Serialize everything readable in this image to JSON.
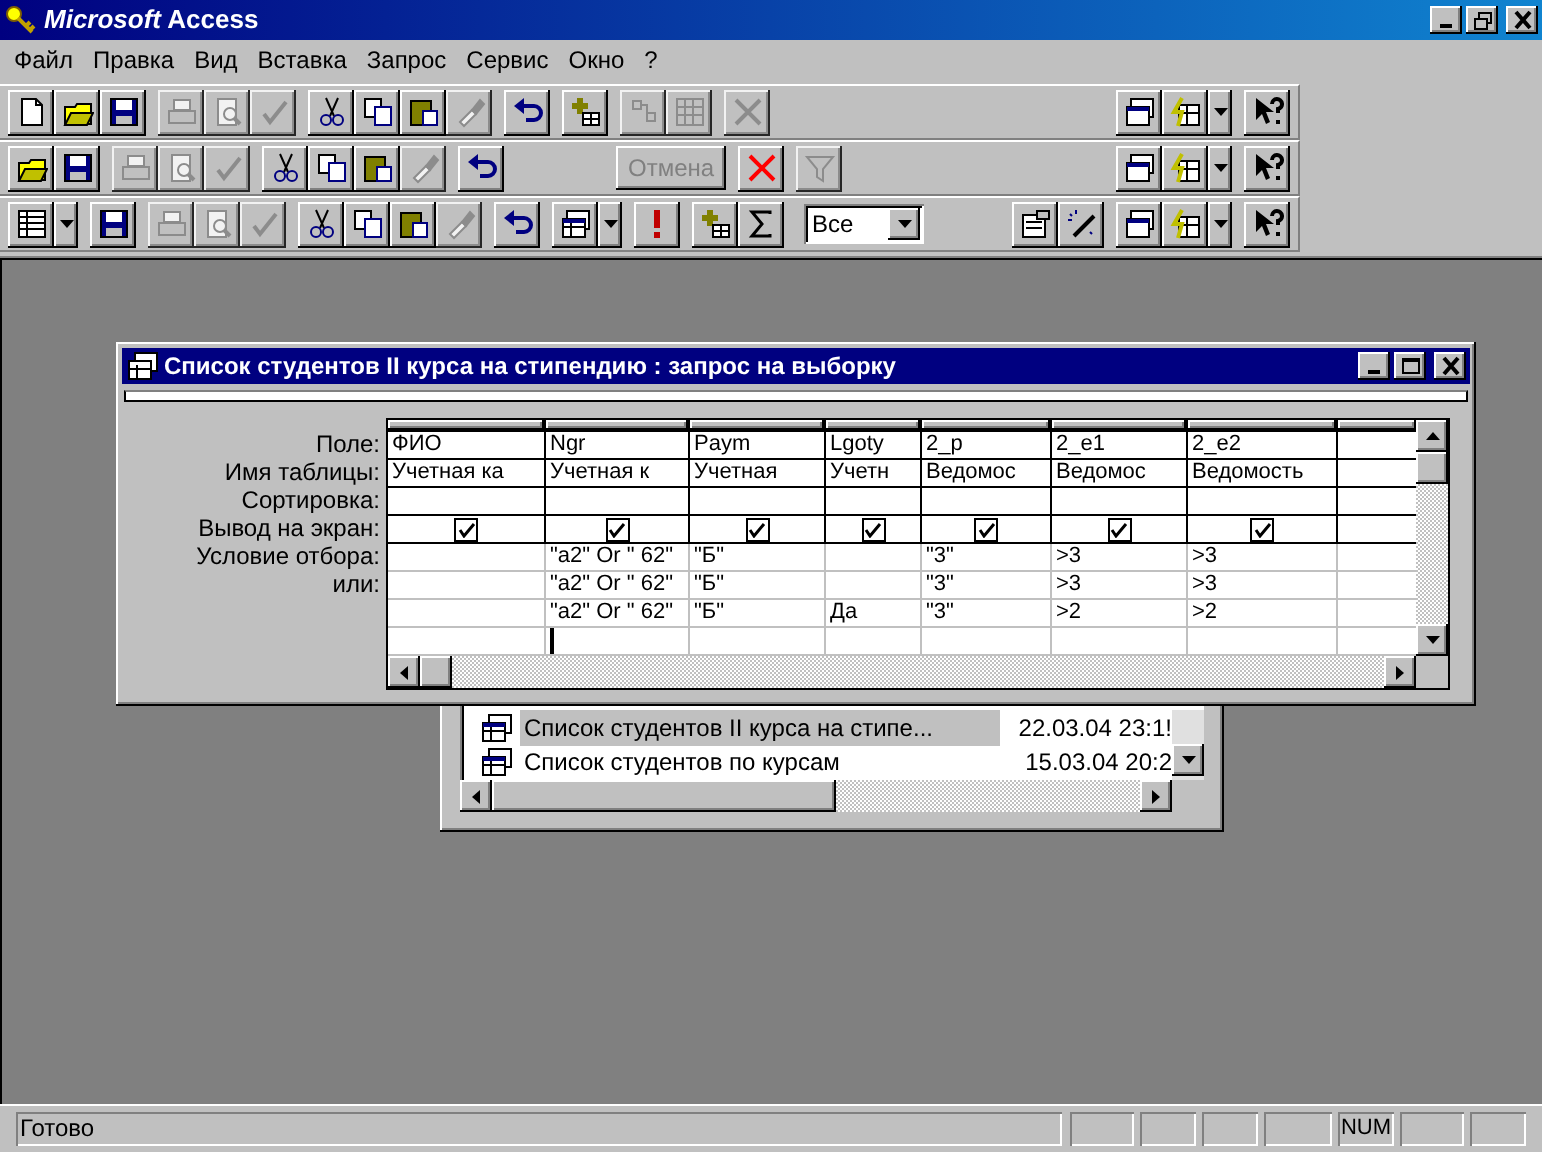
{
  "window": {
    "title": "**Microsoft** Access"
  },
  "menu": [
    "Файл",
    "Правка",
    "Вид",
    "Вставка",
    "Запрос",
    "Сервис",
    "Окно",
    "?"
  ],
  "toolbars": [
    {
      "left": [
        [
          {
            "kind": "new",
            "disabled": false
          },
          {
            "kind": "open",
            "disabled": false
          },
          {
            "kind": "save",
            "disabled": false
          }
        ],
        [
          {
            "kind": "print",
            "disabled": true
          },
          {
            "kind": "preview",
            "disabled": true
          },
          {
            "kind": "spell",
            "disabled": true
          }
        ],
        [
          {
            "kind": "cut",
            "disabled": false
          },
          {
            "kind": "copy",
            "disabled": false
          },
          {
            "kind": "paste",
            "disabled": false
          },
          {
            "kind": "painter",
            "disabled": true
          }
        ],
        [
          {
            "kind": "undo",
            "disabled": false
          }
        ],
        [
          {
            "kind": "new_record",
            "disabled": false
          }
        ],
        [
          {
            "kind": "relations",
            "disabled": true
          },
          {
            "kind": "analyze",
            "disabled": true
          }
        ],
        [
          {
            "kind": "delete",
            "disabled": true
          }
        ]
      ],
      "right": [
        [
          {
            "kind": "db_window",
            "disabled": false
          },
          {
            "kind": "new_object",
            "disabled": false
          }
        ],
        [
          {
            "kind": "help",
            "disabled": false
          }
        ]
      ]
    },
    {
      "left": [
        [
          {
            "kind": "open",
            "disabled": false
          },
          {
            "kind": "save",
            "disabled": false
          }
        ],
        [
          {
            "kind": "print",
            "disabled": true
          },
          {
            "kind": "preview",
            "disabled": true
          },
          {
            "kind": "spell",
            "disabled": true
          }
        ],
        [
          {
            "kind": "cut",
            "disabled": false
          },
          {
            "kind": "copy",
            "disabled": false
          },
          {
            "kind": "paste",
            "disabled": false
          },
          {
            "kind": "painter",
            "disabled": true
          }
        ],
        [
          {
            "kind": "undo",
            "disabled": false
          }
        ],
        [
          {
            "kind": "text",
            "label": "Отмена",
            "disabled": true
          }
        ],
        [
          {
            "kind": "stop",
            "disabled": false
          }
        ],
        [
          {
            "kind": "filter",
            "disabled": true
          }
        ]
      ],
      "right": [
        [
          {
            "kind": "db_window",
            "disabled": false
          },
          {
            "kind": "new_object",
            "disabled": false
          }
        ],
        [
          {
            "kind": "help",
            "disabled": false
          }
        ]
      ]
    },
    {
      "left": [
        [
          {
            "kind": "view",
            "disabled": false
          }
        ],
        [
          {
            "kind": "save",
            "disabled": false
          }
        ],
        [
          {
            "kind": "print",
            "disabled": true
          },
          {
            "kind": "preview",
            "disabled": true
          },
          {
            "kind": "spell",
            "disabled": true
          }
        ],
        [
          {
            "kind": "cut",
            "disabled": false
          },
          {
            "kind": "copy",
            "disabled": false
          },
          {
            "kind": "paste",
            "disabled": false
          },
          {
            "kind": "painter",
            "disabled": true
          }
        ],
        [
          {
            "kind": "undo",
            "disabled": false
          }
        ],
        [
          {
            "kind": "query_type",
            "disabled": false
          }
        ],
        [
          {
            "kind": "run",
            "disabled": false
          }
        ],
        [
          {
            "kind": "show_table",
            "disabled": false
          },
          {
            "kind": "totals",
            "disabled": false
          }
        ],
        [
          {
            "kind": "combo",
            "value": "Все"
          }
        ]
      ],
      "right": [
        [
          {
            "kind": "properties",
            "disabled": false
          },
          {
            "kind": "builder",
            "disabled": false
          }
        ],
        [
          {
            "kind": "db_window",
            "disabled": false
          },
          {
            "kind": "new_object",
            "disabled": false
          }
        ],
        [
          {
            "kind": "help",
            "disabled": false
          }
        ]
      ]
    }
  ],
  "query_window": {
    "title": "Список студентов II курса на стипендию : запрос на выборку",
    "grid": {
      "rows": [
        {
          "label": "Поле:",
          "kind": "text",
          "cells": [
            "ФИО",
            "Ngr",
            "Paym",
            "Lgoty",
            "2_p",
            "2_e1",
            "2_e2"
          ]
        },
        {
          "label": "Имя таблицы:",
          "kind": "text",
          "cells": [
            "Учетная ка",
            "Учетная к",
            "Учетная",
            "Учетн",
            "Ведомос",
            "Ведомос",
            "Ведомость"
          ]
        },
        {
          "label": "Сортировка:",
          "kind": "text",
          "cells": [
            null,
            null,
            null,
            null,
            null,
            null,
            null
          ]
        },
        {
          "label": "Вывод на экран:",
          "kind": "checkbox",
          "cells": [
            {
              "checked": true
            },
            {
              "checked": true
            },
            {
              "checked": true
            },
            {
              "checked": true
            },
            {
              "checked": true
            },
            {
              "checked": true
            },
            {
              "checked": true
            }
          ]
        },
        {
          "label": "Условие отбора:",
          "kind": "text",
          "cells": [
            null,
            "\"a2\" Or \" 62\"",
            "\"Б\"",
            null,
            "\"3\"",
            ">3",
            ">3"
          ]
        },
        {
          "label": "или:",
          "kind": "text",
          "cells": [
            null,
            "\"a2\" Or \" 62\"",
            "\"Б\"",
            null,
            "\"3\"",
            ">3",
            ">3"
          ]
        },
        {
          "kind": "text",
          "cells": [
            null,
            "\"a2\" Or \" 62\"",
            "\"Б\"",
            "Да",
            "\"3\"",
            ">2",
            ">2"
          ]
        },
        {
          "kind": "text",
          "cells": [
            null,
            null,
            null,
            null,
            null,
            null,
            null
          ]
        }
      ]
    }
  },
  "database_window": {
    "items": [
      {
        "name": "Список студентов II курса на стипе...",
        "date": "22.03.04 23:1!",
        "selected": true
      },
      {
        "name": "Список студентов по курсам",
        "date": "15.03.04 20:2",
        "selected": false
      }
    ]
  },
  "status_bar": {
    "text": "Готово",
    "num_lock": "NUM"
  }
}
